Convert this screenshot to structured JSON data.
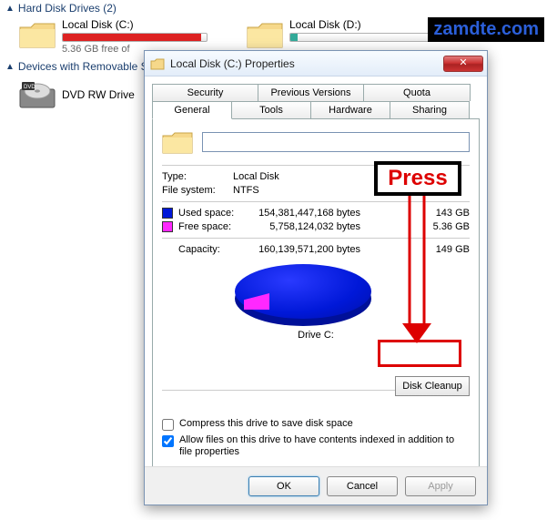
{
  "watermark": "zamdte.com",
  "press_label": "Press",
  "explorer": {
    "section_hdd": "Hard Disk Drives (2)",
    "section_removable": "Devices with Removable Storage",
    "drives": [
      {
        "name": "Local Disk (C:)",
        "sub": "5.36 GB free of",
        "fill_pct": 96
      },
      {
        "name": "Local Disk (D:)",
        "sub": "",
        "fill_pct": 5
      }
    ],
    "dvd_name": "DVD RW Drive"
  },
  "dialog": {
    "title": "Local Disk (C:) Properties",
    "tabs_row1": [
      "Security",
      "Previous Versions",
      "Quota"
    ],
    "tabs_row2": [
      "General",
      "Tools",
      "Hardware",
      "Sharing"
    ],
    "active_tab": "General",
    "name_value": "",
    "type_label": "Type:",
    "type_value": "Local Disk",
    "fs_label": "File system:",
    "fs_value": "NTFS",
    "used_label": "Used space:",
    "used_bytes": "154,381,447,168 bytes",
    "used_gb": "143 GB",
    "free_label": "Free space:",
    "free_bytes": "5,758,124,032 bytes",
    "free_gb": "5.36 GB",
    "cap_label": "Capacity:",
    "cap_bytes": "160,139,571,200 bytes",
    "cap_gb": "149 GB",
    "drive_caption": "Drive C:",
    "cleanup_btn": "Disk Cleanup",
    "compress_label": "Compress this drive to save disk space",
    "index_label": "Allow files on this drive to have contents indexed in addition to file properties",
    "ok": "OK",
    "cancel": "Cancel",
    "apply": "Apply"
  },
  "chart_data": {
    "type": "pie",
    "title": "Drive C:",
    "series": [
      {
        "name": "Used space",
        "value": 154381447168,
        "color": "#0018d8"
      },
      {
        "name": "Free space",
        "value": 5758124032,
        "color": "#ff28ff"
      }
    ]
  }
}
